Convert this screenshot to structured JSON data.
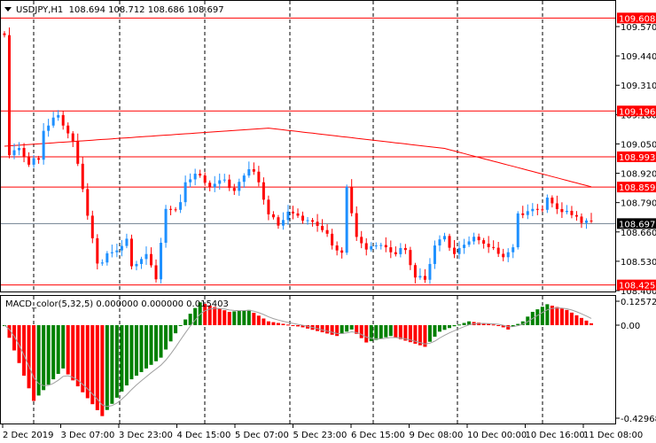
{
  "chart_data": {
    "type": "candlestick",
    "symbol_header": "USDJPY,H1  108.694 108.712 108.686 108.697",
    "ohlc_last": {
      "open": 108.694,
      "high": 108.712,
      "low": 108.686,
      "close": 108.697
    },
    "price_axis": {
      "min": 108.4,
      "max": 109.57,
      "ticks": [
        "109.570",
        "109.440",
        "109.310",
        "109.180",
        "109.050",
        "108.920",
        "108.790",
        "108.660",
        "108.530",
        "108.400"
      ]
    },
    "levels": [
      {
        "label": "109.608",
        "value": 109.608,
        "color": "#ff0000"
      },
      {
        "label": "109.196",
        "value": 109.196,
        "color": "#ff0000"
      },
      {
        "label": "108.993",
        "value": 108.993,
        "color": "#ff0000"
      },
      {
        "label": "108.859",
        "value": 108.859,
        "color": "#ff0000"
      },
      {
        "label": "108.425",
        "value": 108.425,
        "color": "#ff0000"
      }
    ],
    "current_price": {
      "label": "108.697",
      "value": 108.697,
      "color": "#708090"
    },
    "bar_count": 121,
    "close_path": [
      [
        0,
        109.52
      ],
      [
        1,
        109.0
      ],
      [
        3,
        109.02
      ],
      [
        5,
        108.97
      ],
      [
        7,
        108.98
      ],
      [
        8,
        109.12
      ],
      [
        11,
        109.19
      ],
      [
        14,
        109.05
      ],
      [
        16,
        108.85
      ],
      [
        17,
        108.72
      ],
      [
        19,
        108.52
      ],
      [
        22,
        108.57
      ],
      [
        25,
        108.63
      ],
      [
        26,
        108.52
      ],
      [
        29,
        108.55
      ],
      [
        31,
        108.45
      ],
      [
        33,
        108.75
      ],
      [
        36,
        108.78
      ],
      [
        37,
        108.88
      ],
      [
        39,
        108.93
      ],
      [
        42,
        108.87
      ],
      [
        45,
        108.88
      ],
      [
        47,
        108.83
      ],
      [
        50,
        108.95
      ],
      [
        52,
        108.88
      ],
      [
        54,
        108.75
      ],
      [
        56,
        108.7
      ],
      [
        58,
        108.75
      ],
      [
        59,
        108.73
      ],
      [
        62,
        108.7
      ],
      [
        65,
        108.68
      ],
      [
        67,
        108.6
      ],
      [
        69,
        108.58
      ],
      [
        70,
        108.86
      ],
      [
        72,
        108.65
      ],
      [
        74,
        108.57
      ],
      [
        76,
        108.6
      ],
      [
        79,
        108.57
      ],
      [
        82,
        108.58
      ],
      [
        84,
        108.47
      ],
      [
        86,
        108.46
      ],
      [
        88,
        108.6
      ],
      [
        90,
        108.63
      ],
      [
        92,
        108.55
      ],
      [
        95,
        108.63
      ],
      [
        98,
        108.62
      ],
      [
        102,
        108.56
      ],
      [
        104,
        108.58
      ],
      [
        105,
        108.73
      ],
      [
        107,
        108.74
      ],
      [
        110,
        108.77
      ],
      [
        111,
        108.8
      ],
      [
        114,
        108.76
      ],
      [
        117,
        108.74
      ],
      [
        118,
        108.7
      ],
      [
        120,
        108.697
      ]
    ],
    "ma_path": [
      [
        0,
        109.04
      ],
      [
        54,
        109.12
      ],
      [
        90,
        109.03
      ],
      [
        120,
        108.86
      ]
    ],
    "ma_color": "#ff0000",
    "bull_color": "#1e90ff",
    "bear_color": "#ff0000",
    "x_labels": [
      "2 Dec 2019",
      "3 Dec 07:00",
      "3 Dec 23:00",
      "4 Dec 15:00",
      "5 Dec 07:00",
      "5 Dec 23:00",
      "6 Dec 15:00",
      "9 Dec 08:00",
      "10 Dec 00:00",
      "10 Dec 16:00",
      "11 Dec 08:00"
    ],
    "macd": {
      "title": "MACD_color(5,32,5) 0.000000 0.000000 0.015403",
      "axis": {
        "max": 0.125722,
        "min": -0.42968,
        "ticks": [
          "0.125722",
          "0.00",
          "-0.42968"
        ]
      },
      "path": [
        [
          0,
          0
        ],
        [
          6,
          -0.35
        ],
        [
          12,
          -0.2
        ],
        [
          20,
          -0.42
        ],
        [
          26,
          -0.25
        ],
        [
          32,
          -0.15
        ],
        [
          36,
          0
        ],
        [
          40,
          0.12
        ],
        [
          46,
          0.07
        ],
        [
          50,
          0.08
        ],
        [
          54,
          0.02
        ],
        [
          61,
          -0.01
        ],
        [
          68,
          -0.05
        ],
        [
          71,
          -0.02
        ],
        [
          74,
          -0.08
        ],
        [
          79,
          -0.05
        ],
        [
          86,
          -0.1
        ],
        [
          89,
          -0.03
        ],
        [
          95,
          0.02
        ],
        [
          101,
          0
        ],
        [
          103,
          -0.02
        ],
        [
          106,
          0.02
        ],
        [
          108,
          0.07
        ],
        [
          111,
          0.11
        ],
        [
          115,
          0.08
        ],
        [
          120,
          0.01
        ]
      ],
      "up_color": "#008000",
      "down_color": "#ff0000",
      "signal_color": "#a0a0a0"
    }
  }
}
